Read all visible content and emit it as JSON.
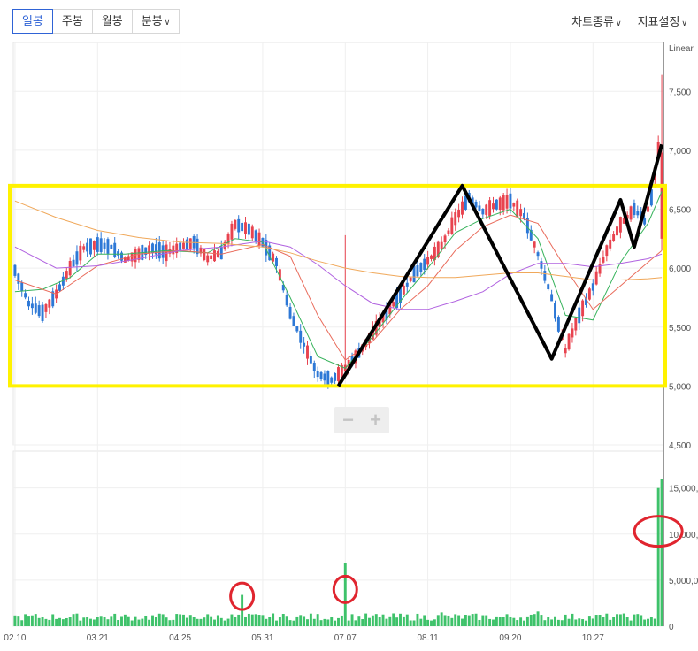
{
  "toolbar": {
    "tabs": [
      {
        "label": "일봉",
        "active": true
      },
      {
        "label": "주봉",
        "active": false
      },
      {
        "label": "월봉",
        "active": false
      },
      {
        "label": "분봉",
        "active": false,
        "dropdown": true
      }
    ],
    "chart_type_label": "차트종류",
    "indicator_label": "지표설정"
  },
  "zoom": {
    "minus": "−",
    "plus": "+"
  },
  "colors": {
    "up": "#e8434f",
    "down": "#2d78d6",
    "volume": "#3ec26a",
    "ma5": "#37b35c",
    "ma20": "#e96b5b",
    "ma60": "#b163e0",
    "ma120": "#f0a85a",
    "highlight_box": "#fff200",
    "annotation_line": "#000000",
    "circle": "#e0252f"
  },
  "chart_data": {
    "type": "candlestick",
    "price_axis": {
      "scale_label": "Linear",
      "ticks": [
        "7,500",
        "7,000",
        "6,500",
        "6,000",
        "5,500",
        "5,000",
        "4,500"
      ],
      "tick_values": [
        7500,
        7000,
        6500,
        6000,
        5500,
        5000,
        4500
      ],
      "range": [
        4500,
        7900
      ]
    },
    "volume_axis": {
      "ticks": [
        "15,000,000",
        "10,000,000",
        "5,000,000",
        "0"
      ],
      "tick_values": [
        15000000,
        10000000,
        5000000,
        0
      ],
      "range": [
        0,
        19000000
      ]
    },
    "x_ticks": [
      "02.10",
      "03.21",
      "04.25",
      "05.31",
      "07.07",
      "08.11",
      "09.20",
      "10.27"
    ],
    "x_tick_index": [
      0,
      24,
      48,
      72,
      96,
      120,
      144,
      168
    ],
    "price_path": [
      [
        0,
        5980
      ],
      [
        4,
        5700
      ],
      [
        8,
        5620
      ],
      [
        12,
        5780
      ],
      [
        16,
        6000
      ],
      [
        20,
        6170
      ],
      [
        24,
        6200
      ],
      [
        28,
        6180
      ],
      [
        32,
        6070
      ],
      [
        36,
        6120
      ],
      [
        40,
        6170
      ],
      [
        44,
        6130
      ],
      [
        48,
        6180
      ],
      [
        52,
        6220
      ],
      [
        56,
        6080
      ],
      [
        60,
        6130
      ],
      [
        64,
        6370
      ],
      [
        68,
        6330
      ],
      [
        72,
        6220
      ],
      [
        74,
        6130
      ],
      [
        76,
        6050
      ],
      [
        80,
        5620
      ],
      [
        84,
        5350
      ],
      [
        88,
        5100
      ],
      [
        92,
        5050
      ],
      [
        96,
        5150
      ],
      [
        100,
        5280
      ],
      [
        104,
        5450
      ],
      [
        108,
        5620
      ],
      [
        112,
        5770
      ],
      [
        116,
        5950
      ],
      [
        120,
        6060
      ],
      [
        124,
        6190
      ],
      [
        128,
        6420
      ],
      [
        132,
        6600
      ],
      [
        136,
        6480
      ],
      [
        140,
        6540
      ],
      [
        144,
        6570
      ],
      [
        148,
        6440
      ],
      [
        152,
        6120
      ],
      [
        156,
        5750
      ],
      [
        160,
        5300
      ],
      [
        164,
        5600
      ],
      [
        168,
        5840
      ],
      [
        172,
        6150
      ],
      [
        176,
        6370
      ],
      [
        180,
        6500
      ],
      [
        183,
        6400
      ],
      [
        185,
        6600
      ],
      [
        187,
        7000
      ]
    ],
    "last_candle": {
      "open": 6250,
      "high": 7640,
      "low": 6150,
      "close": 6980
    },
    "moving_averages": [
      {
        "points": [
          [
            0,
            5800
          ],
          [
            8,
            5820
          ],
          [
            16,
            5920
          ],
          [
            24,
            6120
          ],
          [
            32,
            6120
          ],
          [
            44,
            6150
          ],
          [
            56,
            6130
          ],
          [
            64,
            6250
          ],
          [
            72,
            6220
          ],
          [
            80,
            5750
          ],
          [
            88,
            5250
          ],
          [
            96,
            5150
          ],
          [
            104,
            5420
          ],
          [
            112,
            5720
          ],
          [
            120,
            6000
          ],
          [
            128,
            6300
          ],
          [
            136,
            6420
          ],
          [
            144,
            6500
          ],
          [
            152,
            6250
          ],
          [
            160,
            5600
          ],
          [
            168,
            5560
          ],
          [
            176,
            6050
          ],
          [
            184,
            6380
          ],
          [
            188,
            6650
          ]
        ]
      },
      {
        "points": [
          [
            0,
            5900
          ],
          [
            12,
            5780
          ],
          [
            24,
            6020
          ],
          [
            36,
            6120
          ],
          [
            48,
            6150
          ],
          [
            60,
            6120
          ],
          [
            72,
            6200
          ],
          [
            80,
            6100
          ],
          [
            88,
            5600
          ],
          [
            96,
            5220
          ],
          [
            104,
            5380
          ],
          [
            112,
            5650
          ],
          [
            120,
            5850
          ],
          [
            128,
            6150
          ],
          [
            136,
            6350
          ],
          [
            144,
            6450
          ],
          [
            152,
            6380
          ],
          [
            160,
            6000
          ],
          [
            168,
            5650
          ],
          [
            176,
            5850
          ],
          [
            184,
            6050
          ],
          [
            188,
            6150
          ]
        ]
      },
      {
        "points": [
          [
            0,
            6180
          ],
          [
            12,
            6000
          ],
          [
            24,
            6020
          ],
          [
            36,
            6080
          ],
          [
            48,
            6150
          ],
          [
            60,
            6180
          ],
          [
            72,
            6230
          ],
          [
            80,
            6180
          ],
          [
            88,
            6030
          ],
          [
            96,
            5850
          ],
          [
            104,
            5700
          ],
          [
            112,
            5650
          ],
          [
            120,
            5650
          ],
          [
            128,
            5720
          ],
          [
            136,
            5800
          ],
          [
            144,
            5950
          ],
          [
            152,
            6040
          ],
          [
            160,
            6040
          ],
          [
            168,
            6010
          ],
          [
            176,
            6040
          ],
          [
            184,
            6080
          ],
          [
            188,
            6120
          ]
        ]
      },
      {
        "points": [
          [
            0,
            6570
          ],
          [
            12,
            6430
          ],
          [
            24,
            6320
          ],
          [
            36,
            6260
          ],
          [
            48,
            6220
          ],
          [
            60,
            6210
          ],
          [
            72,
            6180
          ],
          [
            80,
            6130
          ],
          [
            88,
            6060
          ],
          [
            96,
            6000
          ],
          [
            104,
            5960
          ],
          [
            112,
            5930
          ],
          [
            120,
            5920
          ],
          [
            128,
            5920
          ],
          [
            136,
            5940
          ],
          [
            144,
            5960
          ],
          [
            152,
            5960
          ],
          [
            160,
            5930
          ],
          [
            168,
            5900
          ],
          [
            176,
            5900
          ],
          [
            184,
            5910
          ],
          [
            188,
            5920
          ]
        ]
      }
    ],
    "volume_spikes": [
      [
        66,
        3400000
      ],
      [
        96,
        6900000
      ],
      [
        124,
        1500000
      ],
      [
        152,
        1600000
      ],
      [
        176,
        1300000
      ],
      [
        187,
        15000000
      ],
      [
        188,
        16000000
      ]
    ],
    "volume_base": [
      600000,
      1400000
    ],
    "annotations": {
      "box": {
        "y_top": 6700,
        "y_bottom": 5000
      },
      "zigzag": [
        [
          94,
          5000
        ],
        [
          130,
          6700
        ],
        [
          156,
          5230
        ],
        [
          176,
          6580
        ],
        [
          180,
          6180
        ],
        [
          188,
          7050
        ]
      ],
      "circles": [
        {
          "x": 66,
          "volume": 3250000
        },
        {
          "x": 96,
          "volume": 4000000
        },
        {
          "x": 187,
          "volume": 10300000
        }
      ]
    }
  }
}
